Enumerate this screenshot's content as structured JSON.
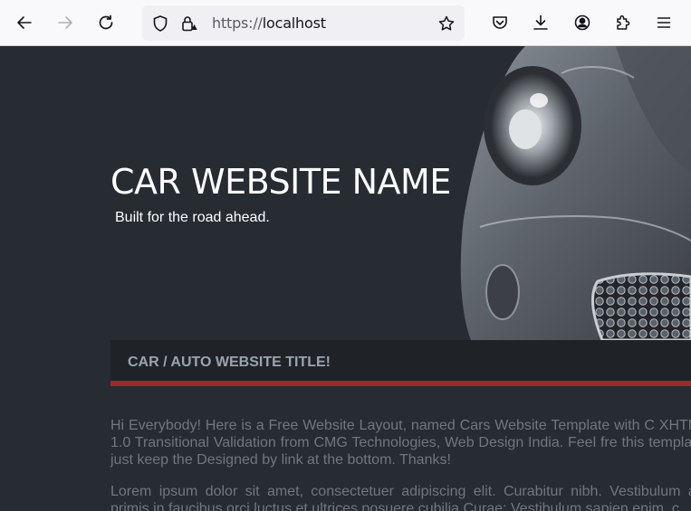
{
  "browser": {
    "url_protocol": "https://",
    "url_host": "localhost"
  },
  "hero": {
    "site_name": "CAR WEBSITE NAME",
    "slogan": "Built for the road ahead."
  },
  "main": {
    "title": "CAR / AUTO WEBSITE TITLE!",
    "paragraphs": [
      "Hi Everybody! Here is a Free Website Layout, named Cars Website Template with C XHTML 1.0 Transitional Validation from CMG Technologies, Web Design India. Feel fre this template, just keep the Designed by link at the bottom. Thanks!",
      "Lorem ipsum dolor sit amet, consectetuer adipiscing elit. Curabitur nibh. Vestibulum ant primis in faucibus orci luctus et ultrices posuere cubilia Curae; Vestibulum sapien enim, c"
    ]
  },
  "colors": {
    "page_bg": "#272b32",
    "accent_bar": "#a0262f",
    "title_text": "#9aa4ae",
    "body_text": "#6f7780"
  }
}
